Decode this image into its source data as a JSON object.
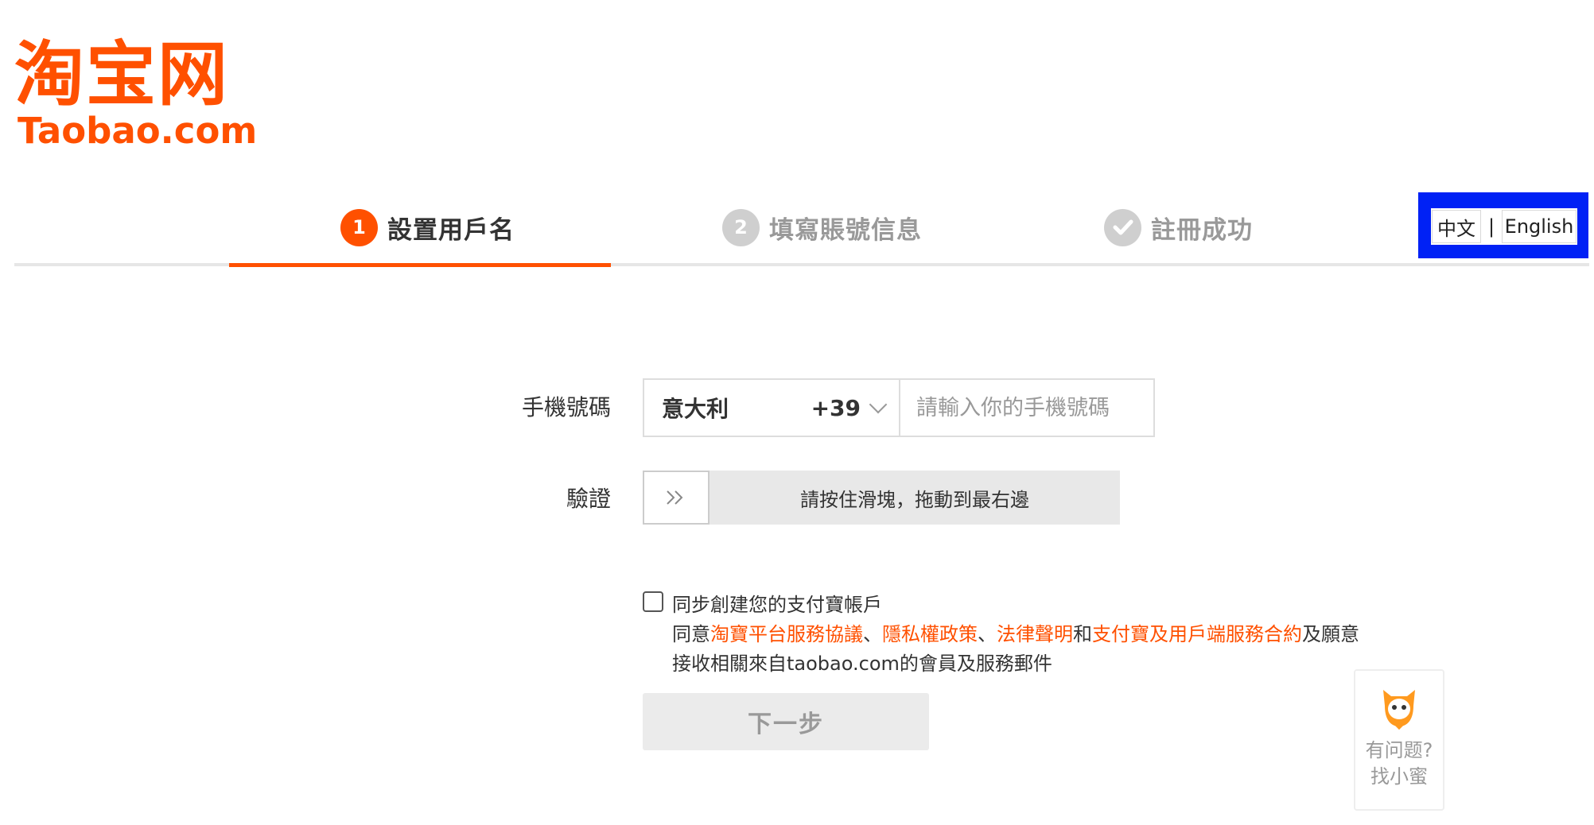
{
  "logo": {
    "cn": "淘宝网",
    "en": "Taobao.com"
  },
  "steps": [
    {
      "number": "1",
      "label": "設置用戶名",
      "state": "active"
    },
    {
      "number": "2",
      "label": "填寫賬號信息",
      "state": "inactive"
    },
    {
      "number": "",
      "label": "註冊成功",
      "state": "inactive",
      "icon": "check-icon"
    }
  ],
  "language": {
    "chinese": "中文",
    "separator": "|",
    "english": "English"
  },
  "form": {
    "phone_label": "手機號碼",
    "country": "意大利",
    "country_code": "+39",
    "phone_placeholder": "請輸入你的手機號碼",
    "phone_value": "",
    "verify_label": "驗證",
    "slider_handle": "»",
    "slider_text": "請按住滑塊，拖動到最右邊"
  },
  "agreement": {
    "checkbox_checked": false,
    "sync_text": "同步創建您的支付寶帳戶",
    "agree_prefix": "同意",
    "link_platform": "淘寶平台服務協議",
    "sep1": "、",
    "link_privacy": "隱私權政策",
    "sep2": "、",
    "link_legal": "法律聲明",
    "and_text": "和",
    "link_alipay": "支付寶及用戶端服務合約",
    "suffix": "及願意",
    "line3": "接收相關來自taobao.com的會員及服務郵件"
  },
  "next_button": "下一步",
  "help": {
    "line1": "有问题?",
    "line2": "找小蜜"
  },
  "colors": {
    "brand": "#ff5000",
    "highlight_box": "#0021f5",
    "inactive": "#cfcfcf"
  }
}
